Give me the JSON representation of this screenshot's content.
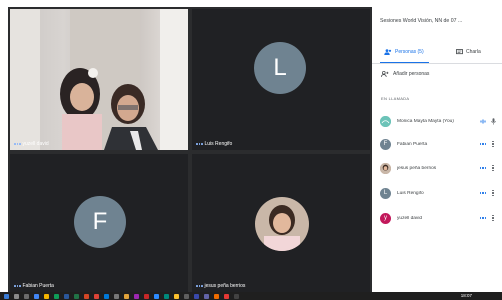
{
  "meeting": {
    "title": "Sesiones World Visión, NN de 07 ..."
  },
  "tabs": [
    {
      "label": "Personas (5)",
      "icon": "people-icon",
      "active": true
    },
    {
      "label": "Charla",
      "icon": "chat-icon",
      "active": false
    }
  ],
  "add_people_label": "Añadir personas",
  "section_label": "EN LLAMADA",
  "participants": [
    {
      "name": "Monica Mayta Mayta (You)",
      "initial": "",
      "color": "#6cc3b8",
      "mic": true
    },
    {
      "name": "Fabian Puerta",
      "initial": "F",
      "color": "#6f8391"
    },
    {
      "name": "jesus peña berrios",
      "initial": "",
      "color": "#b08a77"
    },
    {
      "name": "Luis Rengifo",
      "initial": "L",
      "color": "#6f8391"
    },
    {
      "name": "yuzell david",
      "initial": "y",
      "color": "#c2185b"
    }
  ],
  "tiles": [
    {
      "name": "yuzell david",
      "initial": ""
    },
    {
      "name": "Luis Rengifo",
      "initial": "L",
      "color": "#6f8391"
    },
    {
      "name": "Fabian Puerta",
      "initial": "F",
      "color": "#6f8391"
    },
    {
      "name": "jesus peña berrios",
      "initial": ""
    }
  ],
  "taskbar": {
    "time": "18:07"
  }
}
